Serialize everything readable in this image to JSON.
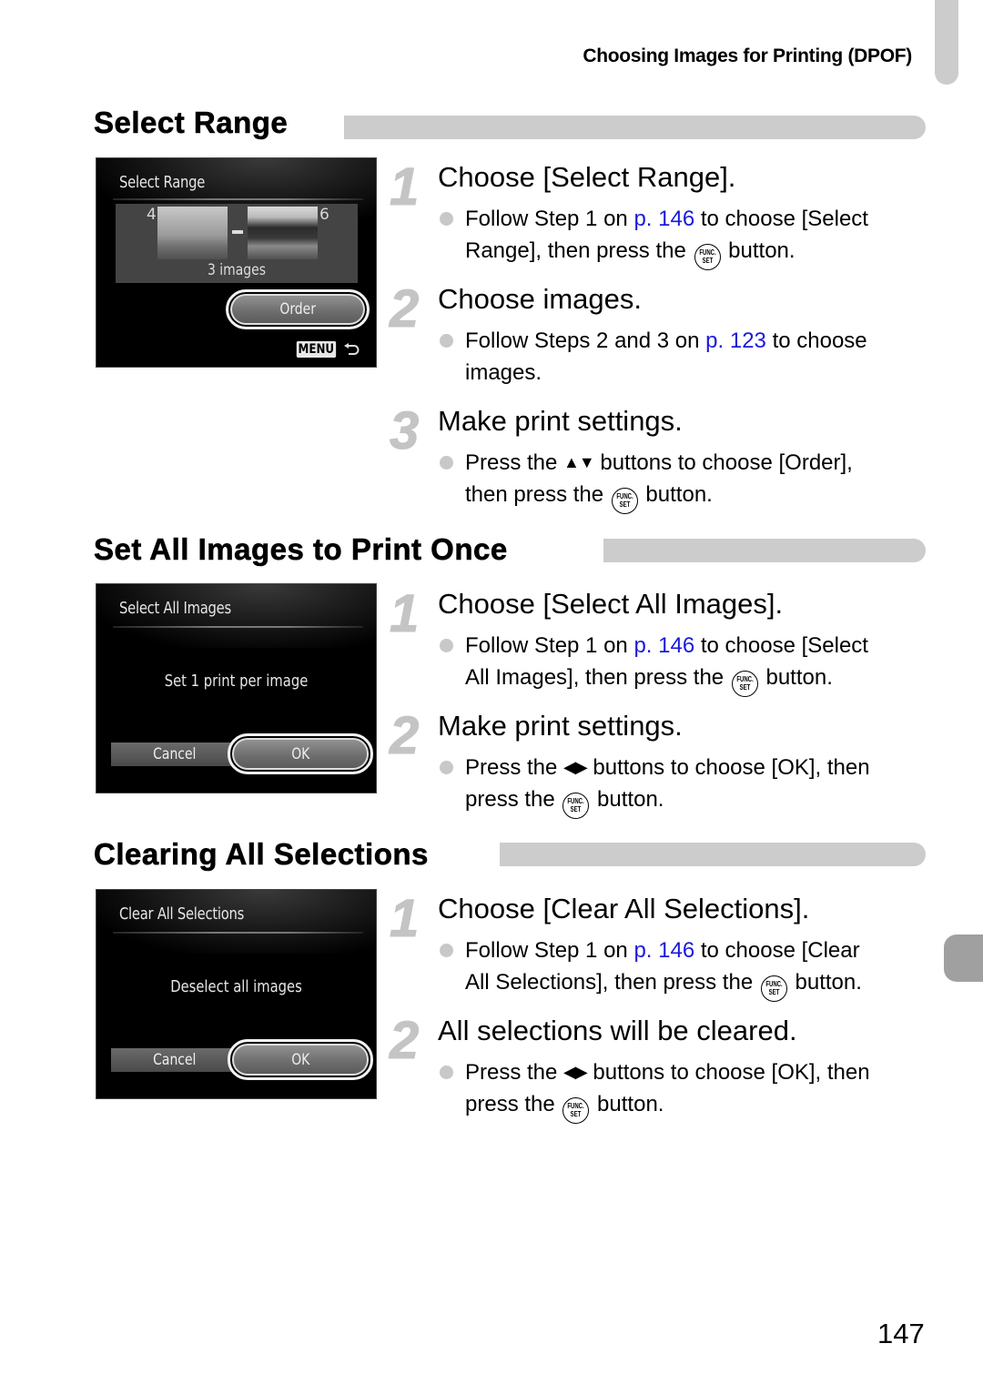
{
  "running_header": "Choosing Images for Printing (DPOF)",
  "page_number": "147",
  "sections": [
    {
      "title": "Select Range",
      "screen": {
        "title": "Select Range",
        "range_start": "4",
        "range_end": "6",
        "image_count": "3 images",
        "button": "Order",
        "menu_label": "MENU"
      },
      "steps": [
        {
          "number": "1",
          "title": "Choose [Select Range].",
          "line1_pre": "Follow Step 1 on ",
          "link": "p. 146",
          "line1_post": " to choose [Select",
          "line2_pre": "Range], then press the ",
          "line2_post": " button."
        },
        {
          "number": "2",
          "title": "Choose images.",
          "line1_pre": "Follow Steps 2 and 3 on ",
          "link": "p. 123",
          "line1_post": " to choose",
          "line2": "images."
        },
        {
          "number": "3",
          "title": "Make print settings.",
          "line1_pre": "Press the ",
          "arrows": "▲▼",
          "line1_post": " buttons to choose [Order],",
          "line2_pre": "then press the ",
          "line2_post": " button."
        }
      ]
    },
    {
      "title": "Set All Images to Print Once",
      "screen": {
        "title": "Select All Images",
        "message": "Set 1 print per image",
        "cancel": "Cancel",
        "ok": "OK"
      },
      "steps": [
        {
          "number": "1",
          "title": "Choose [Select All Images].",
          "line1_pre": "Follow Step 1 on ",
          "link": "p. 146",
          "line1_post": " to choose [Select",
          "line2_pre": "All Images], then press the ",
          "line2_post": " button."
        },
        {
          "number": "2",
          "title": "Make print settings.",
          "line1_pre": "Press the ",
          "arrows": "◀▶",
          "line1_post": " buttons to choose [OK], then",
          "line2_pre": "press the ",
          "line2_post": " button."
        }
      ]
    },
    {
      "title": "Clearing All Selections",
      "screen": {
        "title": "Clear All Selections",
        "message": "Deselect all images",
        "cancel": "Cancel",
        "ok": "OK"
      },
      "steps": [
        {
          "number": "1",
          "title": "Choose [Clear All Selections].",
          "line1_pre": "Follow Step 1 on ",
          "link": "p. 146",
          "line1_post": " to choose [Clear",
          "line2_pre": "All Selections], then press the ",
          "line2_post": " button."
        },
        {
          "number": "2",
          "title": "All selections will be cleared.",
          "line1_pre": "Press the ",
          "arrows": "◀▶",
          "line1_post": " buttons to choose [OK], then",
          "line2_pre": "press the ",
          "line2_post": " button."
        }
      ]
    }
  ],
  "func_icon": {
    "top": "FUNC.",
    "bottom": "SET"
  },
  "colors": {
    "link": "#1a1adc",
    "section_bar": "#cccccc",
    "chapter_tab": "#a0a0a0"
  }
}
